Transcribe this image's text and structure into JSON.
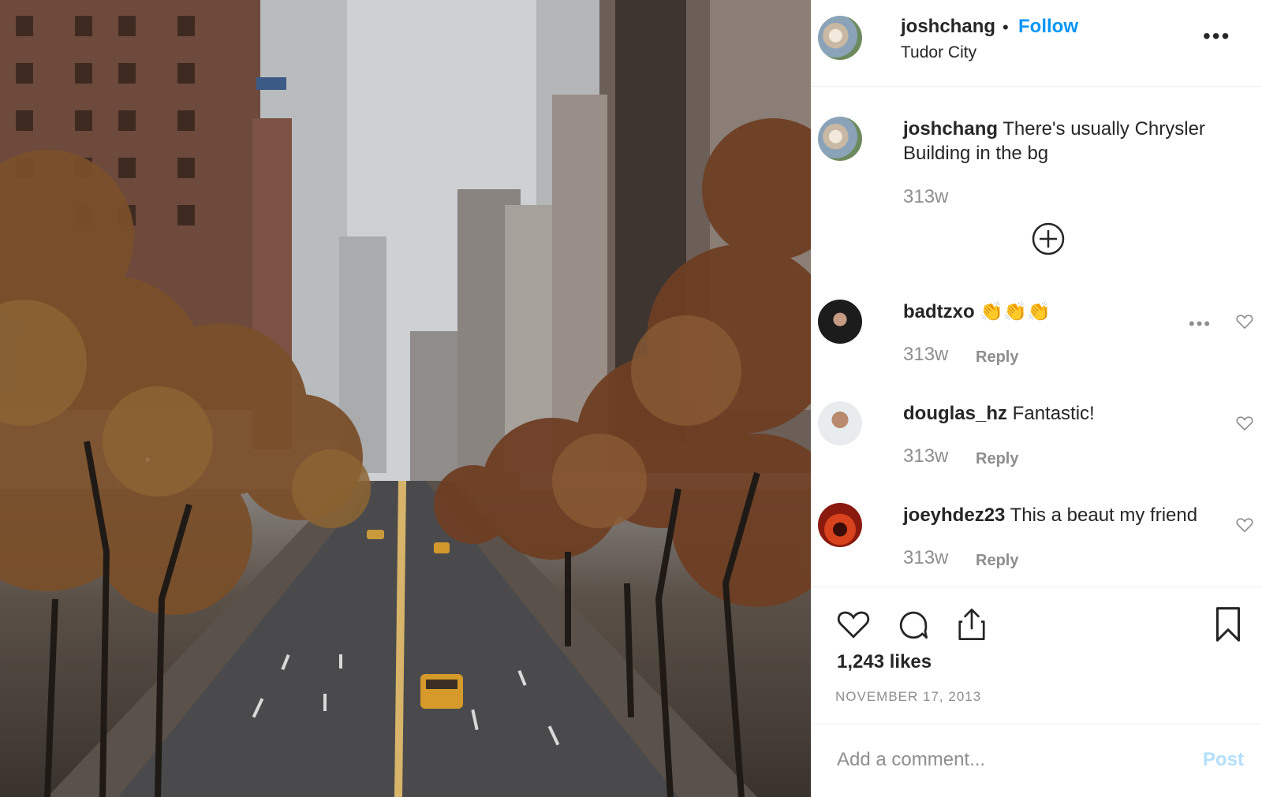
{
  "post": {
    "username": "joshchang",
    "separator": "•",
    "follow_label": "Follow",
    "location": "Tudor City",
    "more_label": "•••"
  },
  "caption": {
    "username": "joshchang",
    "text": " There's usually Chrysler Building in the bg",
    "time": "313w"
  },
  "comments": [
    {
      "username": "badtzxo",
      "text": " 👏👏👏",
      "time": "313w",
      "reply_label": "Reply",
      "more_label": "•••"
    },
    {
      "username": "douglas_hz",
      "text": " Fantastic!",
      "time": "313w",
      "reply_label": "Reply"
    },
    {
      "username": "joeyhdez23",
      "text": " This a beaut my friend",
      "time": "313w",
      "reply_label": "Reply"
    }
  ],
  "likes": "1,243 likes",
  "date": "NOVEMBER 17, 2013",
  "composer": {
    "placeholder": "Add a comment...",
    "post_label": "Post"
  }
}
